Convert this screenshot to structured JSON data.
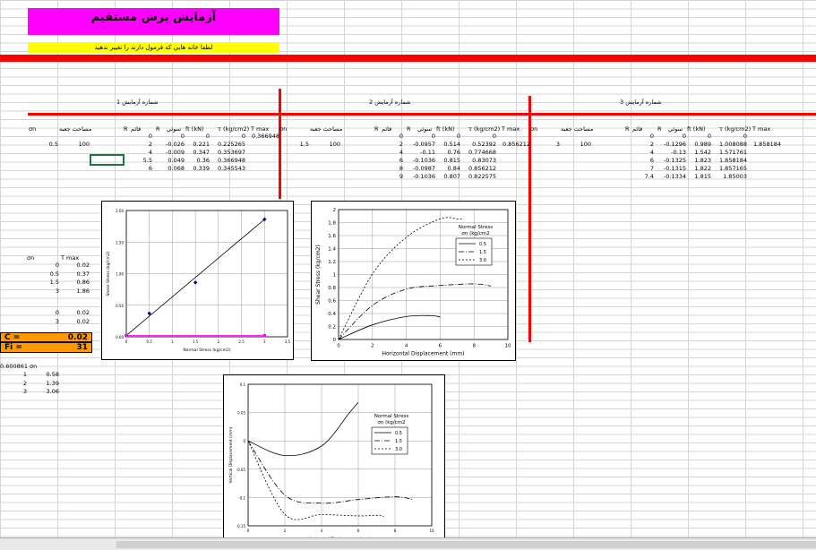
{
  "title": "آزمايش برش مستقيم",
  "warning": "لطفا خانه هايي که فرمول دارند را تغيير ندهيد",
  "colors": {
    "title_bg": "#ff00ff",
    "warning_bg": "#ffff00",
    "rule": "#ff0000",
    "result_bg": "#ff9900"
  },
  "tests": [
    {
      "title": "شماره آزمايش 1",
      "headers": {
        "sn": "σn",
        "area": "مساحت جعبه",
        "dial_r": "R",
        "disp": "قائم",
        "hor_r": "R",
        "horiz": "سوئي",
        "ft": "ft (kN)",
        "tau": "τ (kg/cm2)",
        "tmax": "T max"
      },
      "sn": "0.5",
      "area": "100",
      "rows": [
        [
          "0",
          "",
          "0",
          "0",
          "0"
        ],
        [
          "2",
          "",
          "-0.026",
          "0.221",
          "0.225265"
        ],
        [
          "4",
          "",
          "-0.009",
          "0.347",
          "0.353697"
        ],
        [
          "5.5",
          "",
          "0.049",
          "0.36",
          "0.366948"
        ],
        [
          "6",
          "",
          "0.068",
          "0.339",
          "0.345543"
        ]
      ],
      "tmax": "0.366948"
    },
    {
      "title": "شماره آزمايش 2",
      "headers": {
        "sn": "σn",
        "area": "مساحت جعبه",
        "dial_r": "R",
        "disp": "قائم",
        "hor_r": "R",
        "horiz": "سوئي",
        "ft": "ft (kN)",
        "tau": "τ (kg/cm2)",
        "tmax": "T max"
      },
      "sn": "1.5",
      "area": "100",
      "rows": [
        [
          "0",
          "",
          "0",
          "0",
          "0"
        ],
        [
          "2",
          "",
          "-0.0957",
          "0.514",
          "0.52392"
        ],
        [
          "4",
          "",
          "-0.11",
          "0.76",
          "0.774668"
        ],
        [
          "6",
          "",
          "-0.1036",
          "0.815",
          "0.83073"
        ],
        [
          "8",
          "",
          "-0.0987",
          "0.84",
          "0.856212"
        ],
        [
          "9",
          "",
          "-0.1036",
          "0.807",
          "0.822575"
        ]
      ],
      "tmax": "0.856212"
    },
    {
      "title": "شماره آزمايش 3",
      "headers": {
        "sn": "σn",
        "area": "مساحت جعبه",
        "dial_r": "R",
        "disp": "قائم",
        "hor_r": "R",
        "horiz": "سوئي",
        "ft": "ft (kN)",
        "tau": "τ (kg/cm2)",
        "tmax": "T max"
      },
      "sn": "3",
      "area": "100",
      "rows": [
        [
          "0",
          "",
          "0",
          "0",
          "0"
        ],
        [
          "2",
          "",
          "-0.1296",
          "0.989",
          "1.008088"
        ],
        [
          "4",
          "",
          "-0.13",
          "1.542",
          "1.571761"
        ],
        [
          "6",
          "",
          "-0.1325",
          "1.823",
          "1.858184"
        ],
        [
          "7",
          "",
          "-0.1315",
          "1.822",
          "1.857165"
        ],
        [
          "7.4",
          "",
          "-0.1334",
          "1.815",
          "1.85003"
        ]
      ],
      "tmax": "1.858184"
    }
  ],
  "summary": {
    "h_sn": "σn",
    "h_tmax": "T max",
    "rows": [
      [
        "0",
        "0.02"
      ],
      [
        "0.5",
        "0.37"
      ],
      [
        "1.5",
        "0.86"
      ],
      [
        "3",
        "1.86"
      ]
    ],
    "rows2": [
      [
        "0",
        "0.02"
      ],
      [
        "3",
        "0.02"
      ]
    ],
    "c_label": "C =",
    "c_value": "0.02",
    "fi_label": "Fi =",
    "fi_value": "31"
  },
  "lower_table": {
    "first": "0.600861",
    "head": "σn",
    "rows": [
      [
        "1",
        "0.58"
      ],
      [
        "2",
        "1.39"
      ],
      [
        "3",
        "3.06"
      ]
    ]
  },
  "chart_data": [
    {
      "type": "scatter",
      "title": "",
      "xlabel": "Normal Stress (kg/cm2)",
      "ylabel": "Shear Stress (kg/cm2)",
      "xlim": [
        0,
        3.5
      ],
      "ylim": [
        0,
        2
      ],
      "xticks": [
        "0",
        "0.5",
        "1",
        "1.5",
        "2",
        "2.5",
        "3",
        "3.5"
      ],
      "yticks": [
        "0.00",
        "0.50",
        "1.00",
        "1.50",
        "2.00"
      ],
      "series": [
        {
          "x": [
            0,
            0.5,
            1.5,
            3
          ],
          "y": [
            0.02,
            0.37,
            0.86,
            1.86
          ],
          "color": "#000080"
        },
        {
          "x": [
            0,
            3
          ],
          "y": [
            0.02,
            0.02
          ],
          "color": "#ff00ff"
        }
      ],
      "fit_line": {
        "x": [
          0,
          3
        ],
        "y": [
          0.02,
          1.86
        ]
      }
    },
    {
      "type": "line",
      "xlabel": "Horizontal Displacement (mm)",
      "ylabel": "Shear Stress (kg/cm2)",
      "xlim": [
        0,
        10
      ],
      "ylim": [
        0,
        2
      ],
      "xticks": [
        "0",
        "2",
        "4",
        "6",
        "8",
        "10"
      ],
      "yticks": [
        "0",
        "0.2",
        "0.4",
        "0.6",
        "0.8",
        "1",
        "1.2",
        "1.4",
        "1.6",
        "1.8",
        "2"
      ],
      "legend_title": "Normal Stress\nσn (kg/cm2",
      "legend_position": "top-right",
      "series": [
        {
          "name": "0.5",
          "dash": "",
          "x": [
            0,
            2,
            4,
            5.5,
            6
          ],
          "y": [
            0,
            0.225,
            0.354,
            0.367,
            0.346
          ]
        },
        {
          "name": "1.5",
          "dash": "6,2,1,2",
          "x": [
            0,
            2,
            4,
            6,
            8,
            9
          ],
          "y": [
            0,
            0.524,
            0.775,
            0.831,
            0.856,
            0.823
          ]
        },
        {
          "name": "3.0",
          "dash": "2,2",
          "x": [
            0,
            2,
            4,
            6,
            7,
            7.4
          ],
          "y": [
            0,
            1.008,
            1.572,
            1.858,
            1.857,
            1.85
          ]
        }
      ]
    },
    {
      "type": "line",
      "xlabel": "Horizontal Displacement (mm)",
      "ylabel": "Vertical Displacement (mm)",
      "xlim": [
        0,
        10
      ],
      "ylim": [
        -0.15,
        0.1
      ],
      "xticks": [
        "0",
        "2",
        "4",
        "6",
        "8",
        "10"
      ],
      "yticks": [
        "0.1",
        "0.05",
        "0",
        "-0.05",
        "-0.1",
        "-0.15"
      ],
      "legend_title": "Normal Stress\nσn (kg/cm2",
      "legend_position": "top-right",
      "series": [
        {
          "name": "0.5",
          "dash": "",
          "x": [
            0,
            2,
            4,
            5.5,
            6
          ],
          "y": [
            0,
            -0.026,
            -0.009,
            0.049,
            0.068
          ]
        },
        {
          "name": "1.5",
          "dash": "6,2,1,2",
          "x": [
            0,
            2,
            4,
            6,
            8,
            9
          ],
          "y": [
            0,
            -0.0957,
            -0.11,
            -0.1036,
            -0.0987,
            -0.1036
          ]
        },
        {
          "name": "3.0",
          "dash": "2,2",
          "x": [
            0,
            2,
            4,
            6,
            7,
            7.4
          ],
          "y": [
            0,
            -0.1296,
            -0.13,
            -0.1325,
            -0.1315,
            -0.1334
          ]
        }
      ]
    }
  ]
}
